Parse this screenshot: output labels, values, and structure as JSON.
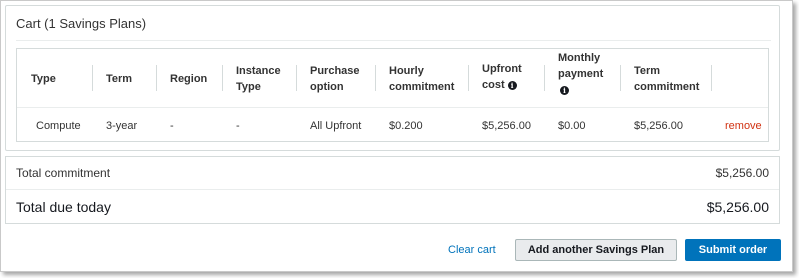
{
  "cart": {
    "title": "Cart (1 Savings Plans)",
    "columns": [
      {
        "line1": "Type",
        "line2": "",
        "line3": ""
      },
      {
        "line1": "Term",
        "line2": "",
        "line3": ""
      },
      {
        "line1": "Region",
        "line2": "",
        "line3": ""
      },
      {
        "line1": "Instance",
        "line2": "Type",
        "line3": ""
      },
      {
        "line1": "Purchase",
        "line2": "option",
        "line3": ""
      },
      {
        "line1": "Hourly",
        "line2": "commitment",
        "line3": ""
      },
      {
        "line1": "Upfront",
        "line2": "cost",
        "line3": "",
        "icon": "info-icon"
      },
      {
        "line1": "Monthly",
        "line2": "payment",
        "line3": "",
        "icon": "info-icon"
      },
      {
        "line1": "Term",
        "line2": "commitment",
        "line3": ""
      }
    ],
    "rows": [
      {
        "type": "Compute",
        "term": "3-year",
        "region": "-",
        "instance_type": "-",
        "purchase_option": "All Upfront",
        "hourly_commitment": "$0.200",
        "upfront_cost": "$5,256.00",
        "monthly_payment": "$0.00",
        "term_commitment": "$5,256.00",
        "action": "remove"
      }
    ]
  },
  "totals": {
    "total_commitment_label": "Total commitment",
    "total_commitment_value": "$5,256.00",
    "total_due_label": "Total due today",
    "total_due_value": "$5,256.00"
  },
  "actions": {
    "clear_cart": "Clear cart",
    "add_another": "Add another Savings Plan",
    "submit": "Submit order"
  },
  "colors": {
    "primary": "#0073bb",
    "remove": "#d13212",
    "link": "#0073bb"
  }
}
